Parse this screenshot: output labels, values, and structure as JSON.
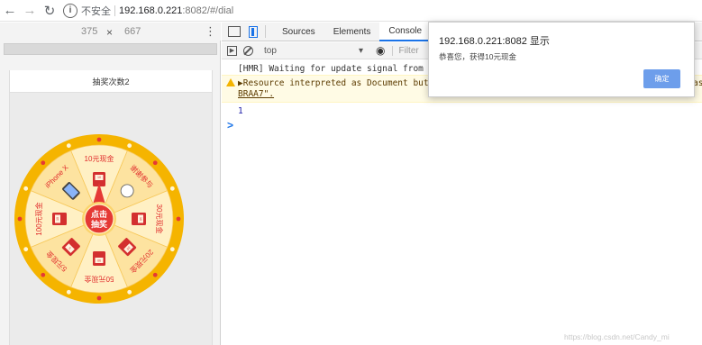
{
  "browser": {
    "not_secure": "不安全",
    "url_host": "192.168.0.221",
    "url_rest": ":8082/#/dial"
  },
  "device": {
    "width": "375",
    "times": "×",
    "height": "667"
  },
  "page": {
    "title": "抽奖次数2"
  },
  "wheel": {
    "center_line1": "点击",
    "center_line2": "抽奖",
    "prizes": [
      "10元现金",
      "谢谢参与",
      "30元现金",
      "20元现金",
      "50元现金",
      "5元现金",
      "100元现金",
      "iPhone X"
    ],
    "icon_labels": [
      "10",
      "",
      "10",
      "20",
      "50",
      "5",
      "10",
      ""
    ],
    "colors": {
      "rim": "#f5b400",
      "seg_light": "#fff0c4",
      "seg_dark": "#fde3a0",
      "text": "#e02b2b",
      "center": "#e53935"
    }
  },
  "devtools": {
    "tabs": [
      "Sources",
      "Elements",
      "Console"
    ],
    "active_tab": "Console",
    "context": "top",
    "filter_placeholder": "Filter",
    "log1": "[HMR] Waiting for update signal from WDS",
    "log2": "▶Resource interpreted as Document but t",
    "log2_tail": "as",
    "log2b": "BRAA7\".",
    "log3": "1",
    "prompt": ">"
  },
  "dialog": {
    "title": "192.168.0.221:8082 显示",
    "message": "恭喜您，获得10元现金",
    "ok": "确定"
  },
  "watermark": "https://blog.csdn.net/Candy_mi"
}
